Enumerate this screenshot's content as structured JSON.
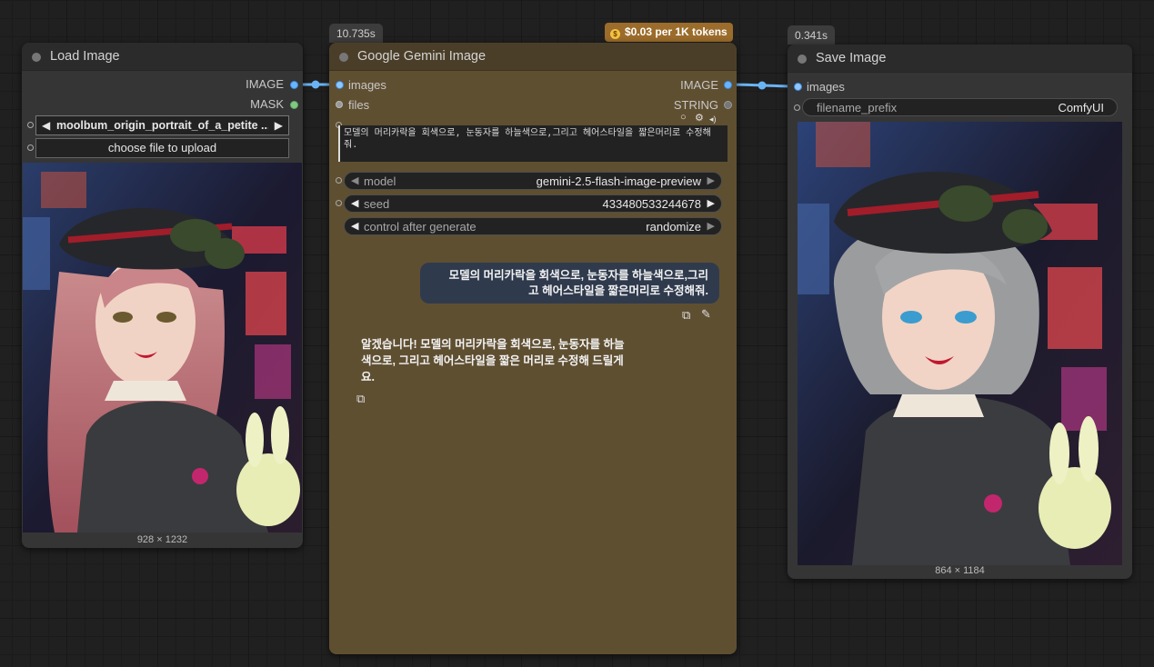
{
  "nodes": {
    "load_image": {
      "title": "Load Image",
      "outputs": [
        "IMAGE",
        "MASK"
      ],
      "image_select": "moolbum_origin_portrait_of_a_petite ...",
      "upload_button": "choose file to upload",
      "image_size": "928 × 1232"
    },
    "gemini": {
      "title": "Google Gemini Image",
      "timer": "10.735s",
      "cost_badge": "$0.03 per 1K tokens",
      "inputs": [
        "images",
        "files"
      ],
      "outputs": [
        "IMAGE",
        "STRING"
      ],
      "prompt": "모델의 머리카락을 회색으로, 눈동자를 하늘색으로,그리고 헤어스타일을 짧은머리로 수정해줘.",
      "widgets": {
        "model": {
          "name": "model",
          "value": "gemini-2.5-flash-image-preview"
        },
        "seed": {
          "name": "seed",
          "value": "433480533244678"
        },
        "control": {
          "name": "control after generate",
          "value": "randomize"
        }
      },
      "chat": {
        "user_message": "모델의 머리카락을 회색으로, 눈동자를 하늘색으로,그리고 헤어스타일을 짧은머리로 수정해줘.",
        "user_line1": "모델의 머리카락을 회색으로, 눈동자를 하늘색으로,그리",
        "user_line2": "고 헤어스타일을 짧은머리로 수정해줘.",
        "reply_line1": "알겠습니다! 모델의 머리카락을 회색으로, 눈동자를 하늘",
        "reply_line2": "색으로, 그리고 헤어스타일을 짧은 머리로 수정해 드릴게",
        "reply_line3": "요."
      }
    },
    "save_image": {
      "title": "Save Image",
      "timer": "0.341s",
      "inputs": [
        "images"
      ],
      "filename_prefix": {
        "name": "filename_prefix",
        "value": "ComfyUI"
      },
      "image_size": "864 × 1184"
    }
  },
  "icons": {
    "coin": "$",
    "copy": "copy-icon",
    "edit": "pencil-icon"
  },
  "colors": {
    "image_link": "#6ab4f5",
    "gemini_node": "#5f4f31",
    "canvas": "#202020"
  }
}
